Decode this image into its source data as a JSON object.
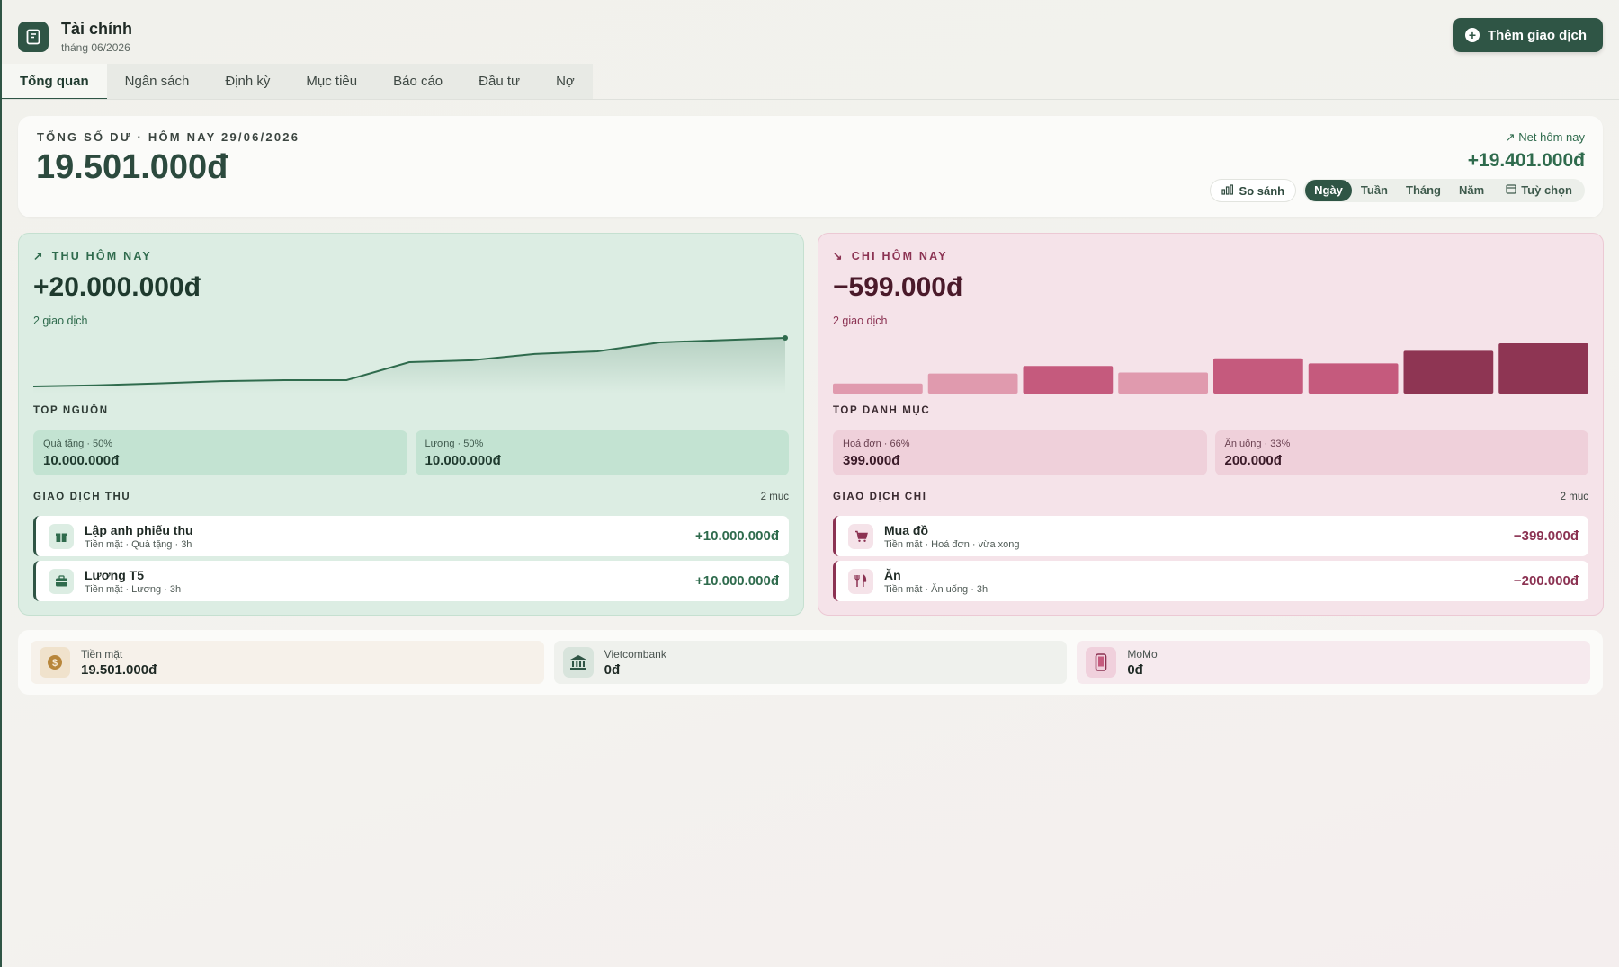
{
  "app": {
    "title": "Tài chính",
    "subtitle": "tháng 06/2026",
    "add_button": "Thêm giao dịch"
  },
  "tabs": [
    {
      "label": "Tổng quan",
      "active": true
    },
    {
      "label": "Ngân sách"
    },
    {
      "label": "Định kỳ"
    },
    {
      "label": "Mục tiêu"
    },
    {
      "label": "Báo cáo"
    },
    {
      "label": "Đầu tư"
    },
    {
      "label": "Nợ"
    }
  ],
  "balance": {
    "label": "TỔNG SỐ DƯ · HÔM NAY 29/06/2026",
    "amount": "19.501.000đ",
    "net_label": "Net hôm nay",
    "net_value": "+19.401.000đ",
    "compare_label": "So sánh",
    "periods": [
      "Ngày",
      "Tuần",
      "Tháng",
      "Năm"
    ],
    "active_period": "Ngày",
    "custom_label": "Tuỳ chọn"
  },
  "income": {
    "label": "THU HÔM NAY",
    "amount": "+20.000.000đ",
    "count": "2 giao dịch",
    "sources_label": "TOP NGUỒN",
    "sources": [
      {
        "label": "Quà tặng · 50%",
        "value": "10.000.000đ"
      },
      {
        "label": "Lương · 50%",
        "value": "10.000.000đ"
      }
    ],
    "tx_label": "GIAO DỊCH THU",
    "tx_count": "2 mục",
    "transactions": [
      {
        "title": "Lập anh phiếu thu",
        "meta": "Tiền mặt · Quà tặng · 3h",
        "amount": "+10.000.000đ",
        "icon": "gift-icon"
      },
      {
        "title": "Lương T5",
        "meta": "Tiền mặt · Lương · 3h",
        "amount": "+10.000.000đ",
        "icon": "briefcase-icon"
      }
    ],
    "trend": [
      0.0,
      0.3,
      0.8,
      1.4,
      1.7,
      1.7,
      6.5,
      7.0,
      8.7,
      9.4,
      11.8,
      12.4,
      13.0
    ]
  },
  "expense": {
    "label": "CHI HÔM NAY",
    "amount": "−599.000đ",
    "count": "2 giao dịch",
    "categories_label": "TOP DANH MỤC",
    "categories": [
      {
        "label": "Hoá đơn · 66%",
        "value": "399.000đ"
      },
      {
        "label": "Ăn uống · 33%",
        "value": "200.000đ"
      }
    ],
    "tx_label": "GIAO DỊCH CHI",
    "tx_count": "2 mục",
    "transactions": [
      {
        "title": "Mua đồ",
        "meta": "Tiền mặt · Hoá đơn · vừa xong",
        "amount": "−399.000đ",
        "icon": "cart-icon"
      },
      {
        "title": "Ăn",
        "meta": "Tiền mặt · Ăn uống · 3h",
        "amount": "−200.000đ",
        "icon": "utensils-icon"
      }
    ],
    "bars": [
      0.2,
      0.4,
      0.55,
      0.42,
      0.7,
      0.6,
      0.85,
      1.0
    ],
    "bar_colors": [
      "#e09aae",
      "#e09aae",
      "#c55a7d",
      "#e09aae",
      "#c55a7d",
      "#c55a7d",
      "#8e3553",
      "#8e3553"
    ]
  },
  "accounts": [
    {
      "name": "Tiền mặt",
      "balance": "19.501.000đ",
      "icon": "coin-icon"
    },
    {
      "name": "Vietcombank",
      "balance": "0đ",
      "icon": "bank-icon"
    },
    {
      "name": "MoMo",
      "balance": "0đ",
      "icon": "phone-icon"
    }
  ],
  "colors": {
    "primary": "#2f5545",
    "income": "#2f6b4d",
    "expense": "#8b3252"
  }
}
